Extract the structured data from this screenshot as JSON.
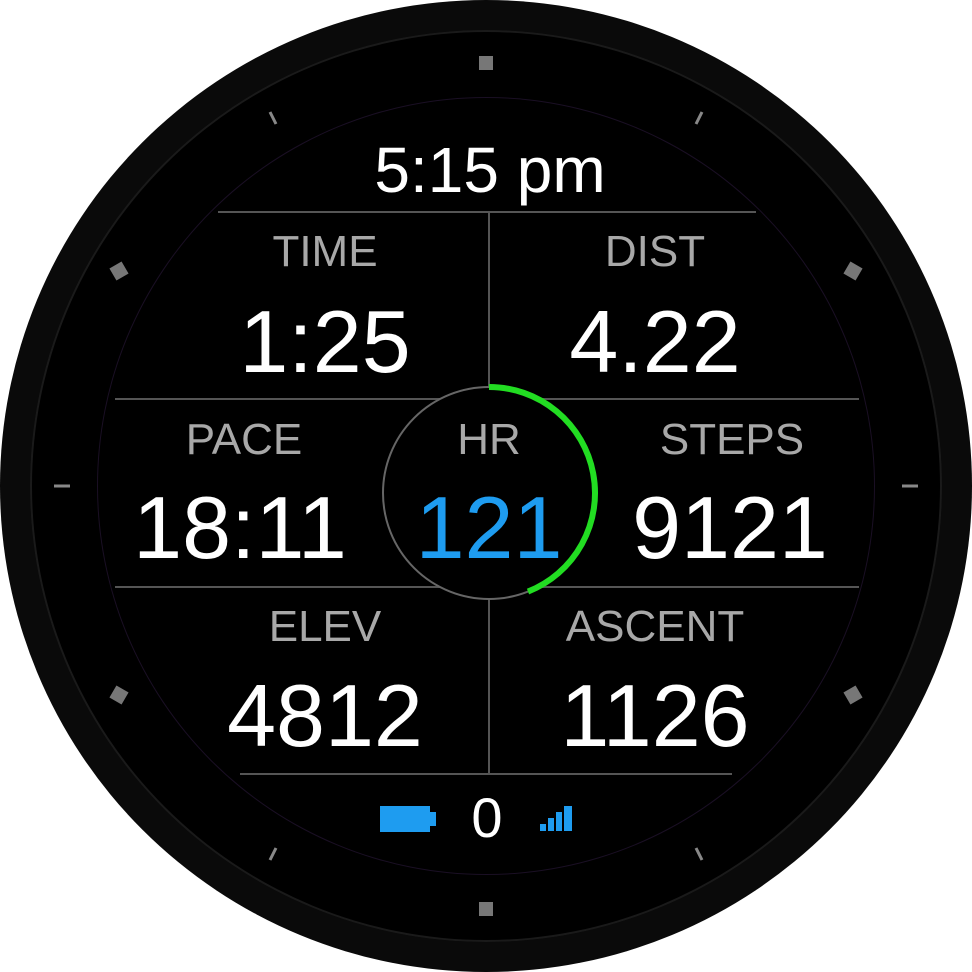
{
  "clock": {
    "time": "5:15 pm"
  },
  "fields": {
    "time": {
      "label": "TIME",
      "value": "1:25"
    },
    "dist": {
      "label": "DIST",
      "value": "4.22"
    },
    "pace": {
      "label": "PACE",
      "value": "18:11"
    },
    "hr": {
      "label": "HR",
      "value": "121",
      "color": "#1e9cf0"
    },
    "steps": {
      "label": "STEPS",
      "value": "9121"
    },
    "elev": {
      "label": "ELEV",
      "value": "4812"
    },
    "ascent": {
      "label": "ASCENT",
      "value": "1126"
    }
  },
  "hr_gauge": {
    "fill_fraction": 0.44,
    "color": "#22dd22"
  },
  "status": {
    "battery_icon": "battery-icon",
    "battery_color": "#1e9cf0",
    "notifications": "0",
    "signal_icon": "signal-bars-icon"
  }
}
